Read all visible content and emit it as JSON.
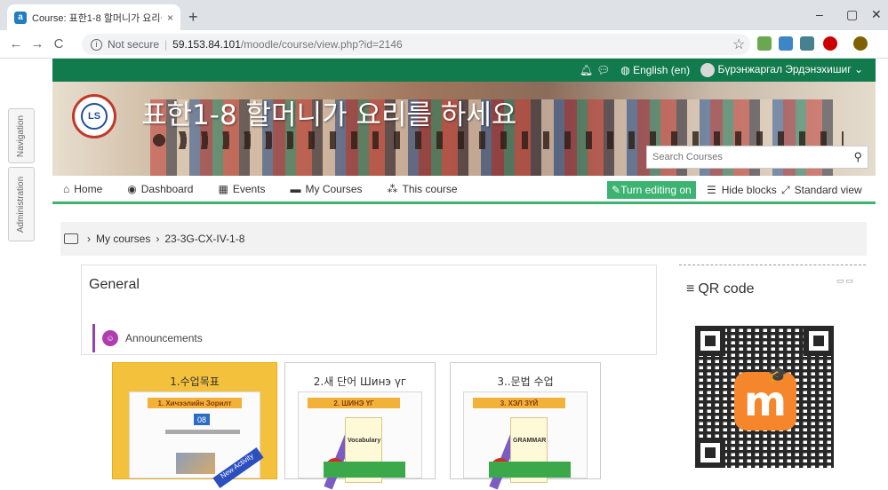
{
  "browser": {
    "tab_title": "Course: 표한1-8 할머니가 요리를",
    "tab_close": "×",
    "new_tab": "+",
    "back": "←",
    "forward": "→",
    "reload": "C",
    "info_symbol": "i",
    "security_label": "Not secure",
    "url_separator": "|",
    "url_host": "59.153.84.101",
    "url_path": "/moodle/course/view.php?id=2146",
    "star": "☆",
    "win_min": "–",
    "win_max": "▢",
    "win_close": "✕",
    "colors": {
      "tab_bg": "#dee1e6",
      "omnibox_bg": "#f1f3f4"
    }
  },
  "topnav": {
    "icons": [
      "bell-icon",
      "chat-icon"
    ],
    "language": "English (en)",
    "user_name": "Бүрэнжаргал Эрдэнэхишиг",
    "caret": "⌄",
    "color": "#117b4d"
  },
  "banner": {
    "course_title": "표한1-8 할머니가 요리를 하세요",
    "logo_text": "LS",
    "search_placeholder": "Search Courses",
    "search_icon": "search-icon"
  },
  "navbar": {
    "items": [
      {
        "label": "Home",
        "icon": "home-icon",
        "glyph": "⌂"
      },
      {
        "label": "Dashboard",
        "icon": "dashboard-icon",
        "glyph": "◉"
      },
      {
        "label": "Events",
        "icon": "calendar-icon",
        "glyph": "▦"
      },
      {
        "label": "My Courses",
        "icon": "courses-icon",
        "glyph": "▬"
      },
      {
        "label": "This course",
        "icon": "sitemap-icon",
        "glyph": "⁂"
      }
    ],
    "edit_button": "Turn editing on",
    "edit_glyph": "✎",
    "hide_blocks": "Hide blocks",
    "hide_glyph": "☰",
    "standard_view": "Standard view",
    "standard_glyph": "⤢",
    "accent": "#3cb371"
  },
  "side_tabs": {
    "navigation": "Navigation",
    "administration": "Administration"
  },
  "breadcrumb": {
    "sep": "›",
    "items": [
      "My courses",
      "23-3G-CX-IV-1-8"
    ]
  },
  "section": {
    "title": "General",
    "announcements": "Announcements",
    "forum_glyph": "☺"
  },
  "cards": [
    {
      "title": "1.수업목표",
      "doc_header": "1. Хичээлийн Зорилт",
      "doc_number": "08",
      "ribbon": "New Activity"
    },
    {
      "title": "2.새 단어 Шинэ үг",
      "doc_header": "2. ШИНЭ ҮГ",
      "notebook_label": "Vocabulary"
    },
    {
      "title": "3..문법 수업",
      "doc_header": "3. ХЭЛ ЗҮЙ",
      "notebook_label": "GRAMMAR"
    }
  ],
  "qr_block": {
    "title": "QR code",
    "menu_glyph": "≡",
    "controls": "▭▭",
    "logo_letter": "m",
    "cap_glyph": "🎓"
  }
}
